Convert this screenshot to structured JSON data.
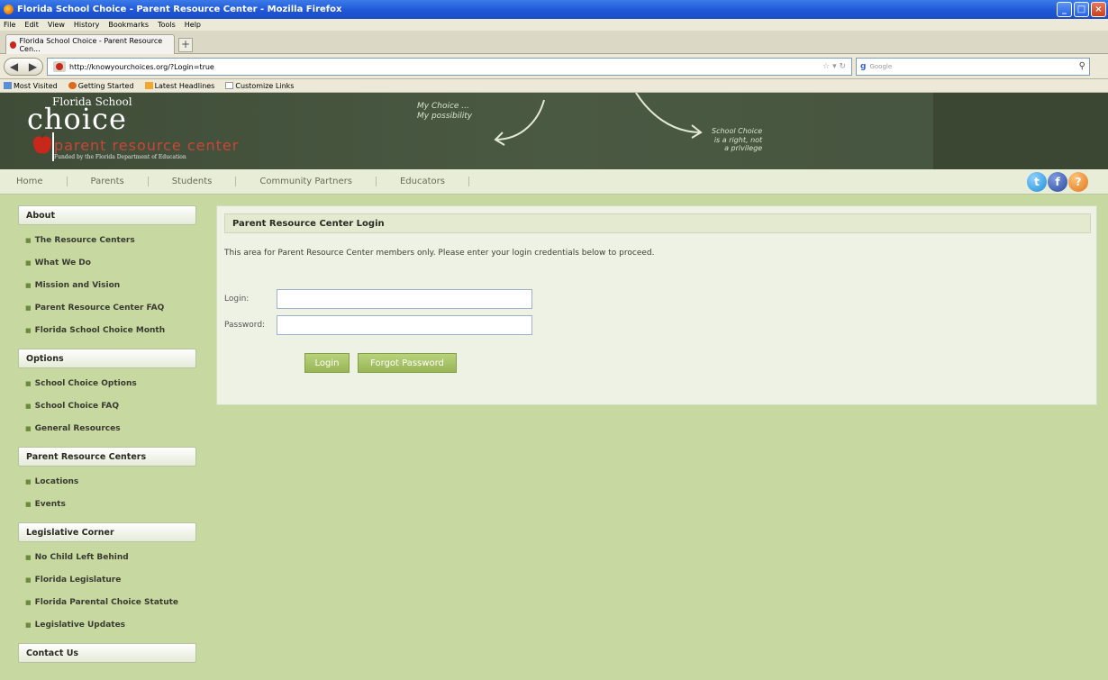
{
  "browser": {
    "window_title": "Florida School Choice - Parent Resource Center - Mozilla Firefox",
    "menu": [
      "File",
      "Edit",
      "View",
      "History",
      "Bookmarks",
      "Tools",
      "Help"
    ],
    "tab_title": "Florida School Choice - Parent Resource Cen...",
    "url": "http://knowyourchoices.org/?Login=true",
    "search_placeholder": "Google",
    "bookmarks": [
      "Most Visited",
      "Getting Started",
      "Latest Headlines",
      "Customize Links"
    ]
  },
  "banner": {
    "logo_top": "Florida School",
    "logo_main": "choice",
    "logo_sub": "parent resource center",
    "logo_funded": "Funded by the Florida Department of Education",
    "chalk_left": "My Choice ...\nMy possibility",
    "chalk_right": "School Choice\nis a right, not\na privilege"
  },
  "nav": {
    "items": [
      "Home",
      "Parents",
      "Students",
      "Community Partners",
      "Educators"
    ],
    "social": [
      "twitter-icon",
      "facebook-icon",
      "help-icon"
    ]
  },
  "sidebar": {
    "sections": [
      {
        "title": "About",
        "items": [
          "The Resource Centers",
          "What We Do",
          "Mission and Vision",
          "Parent Resource Center FAQ",
          "Florida School Choice Month"
        ]
      },
      {
        "title": "Options",
        "items": [
          "School Choice Options",
          "School Choice FAQ",
          "General Resources"
        ]
      },
      {
        "title": "Parent Resource Centers",
        "items": [
          "Locations",
          "Events"
        ]
      },
      {
        "title": "Legislative Corner",
        "items": [
          "No Child Left Behind",
          "Florida Legislature",
          "Florida Parental Choice Statute",
          "Legislative Updates"
        ]
      },
      {
        "title": "Contact Us",
        "items": []
      }
    ]
  },
  "login": {
    "title": "Parent Resource Center Login",
    "intro": "This area for Parent Resource Center members only. Please enter your login credentials below to proceed.",
    "login_label": "Login:",
    "password_label": "Password:",
    "login_value": "",
    "password_value": "",
    "login_button": "Login",
    "forgot_button": "Forgot Password"
  },
  "colors": {
    "page_bg": "#c7d9a1",
    "banner_bg": "#4a5942",
    "button_green": "#a6c166",
    "logo_red": "#c94637"
  }
}
